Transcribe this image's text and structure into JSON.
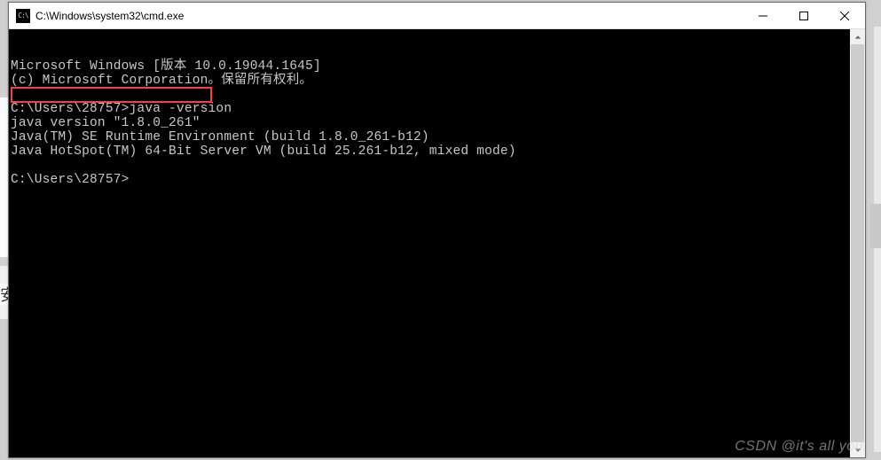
{
  "window": {
    "title": "C:\\Windows\\system32\\cmd.exe",
    "icon_label": "cmd-icon"
  },
  "terminal": {
    "lines": [
      "Microsoft Windows [版本 10.0.19044.1645]",
      "(c) Microsoft Corporation。保留所有权利。",
      "",
      "C:\\Users\\28757>java -version",
      "java version \"1.8.0_261\"",
      "Java(TM) SE Runtime Environment (build 1.8.0_261-b12)",
      "Java HotSpot(TM) 64-Bit Server VM (build 25.261-b12, mixed mode)",
      "",
      "C:\\Users\\28757>"
    ],
    "prompt_path": "C:\\Users\\28757",
    "command": "java -version",
    "highlighted_line_index": 4
  },
  "background_visible_char": "安",
  "watermark": "CSDN @it's all you"
}
